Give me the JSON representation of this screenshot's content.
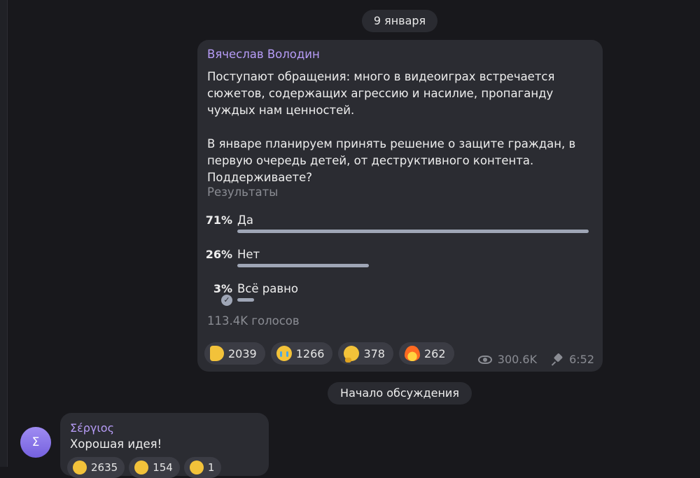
{
  "date_pill": "9 января",
  "post": {
    "author": "Вячеслав Володин",
    "text": "Поступают обращения: много в видеоиграх встречается сюжетов, содержащих агрессию и насилие, пропаганду чуждых нам ценностей.\n\nВ январе планируем принять решение о защите граждан, в первую очередь детей, от деструктивного контента. Поддерживаете?",
    "results_label": "Результаты",
    "poll": {
      "options": [
        {
          "percent": "71%",
          "label": "Да",
          "value": 71
        },
        {
          "percent": "26%",
          "label": "Нет",
          "value": 26
        },
        {
          "percent": "3%",
          "label": "Всё равно",
          "value": 3,
          "checked": true
        }
      ],
      "votes": "113.4K голосов"
    },
    "reactions": [
      {
        "icon": "thumbs-up",
        "count": "2039"
      },
      {
        "icon": "crying-face",
        "count": "1266"
      },
      {
        "icon": "thinking-face",
        "count": "378"
      },
      {
        "icon": "fire",
        "count": "262"
      }
    ],
    "views": "300.6K",
    "time": "6:52",
    "colors": {
      "accent": "#b79cf7",
      "bar": "#9fa6b6",
      "bubble": "#2b2c32",
      "background": "#18181c"
    }
  },
  "discussion_label": "Начало обсуждения",
  "comment": {
    "avatar_letter": "Σ",
    "author": "Σέργιος",
    "text": "Хорошая идея!",
    "reactions": [
      {
        "icon": "clapping-hands",
        "count": "2635"
      },
      {
        "icon": "thumbs-up",
        "count": "154"
      },
      {
        "icon": "party-face",
        "count": "1"
      }
    ]
  }
}
